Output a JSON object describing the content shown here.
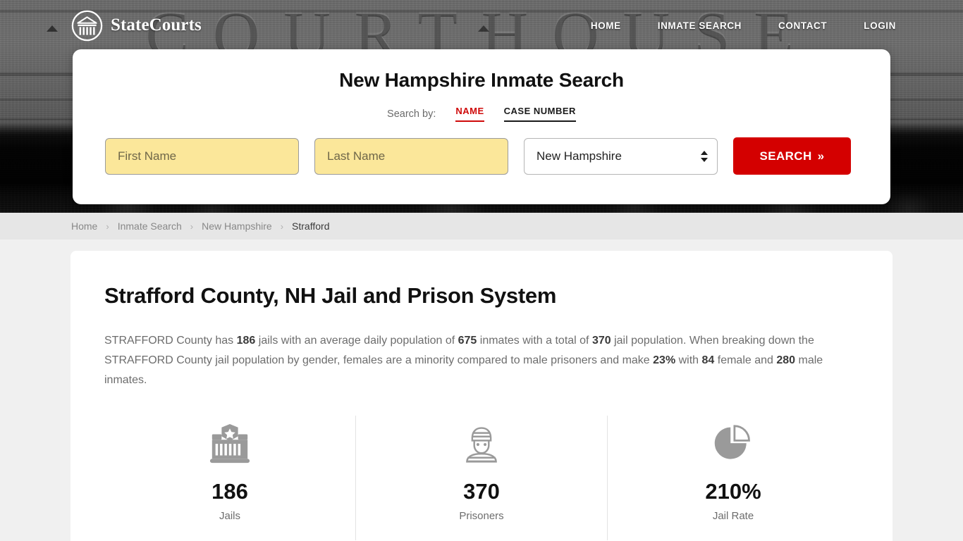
{
  "header": {
    "brand_name": "StateCourts",
    "brand_icon": "courthouse-logo-icon",
    "hero_watermark": "COURTHOUSE",
    "nav": [
      {
        "label": "HOME"
      },
      {
        "label": "INMATE SEARCH"
      },
      {
        "label": "CONTACT"
      },
      {
        "label": "LOGIN"
      }
    ]
  },
  "search": {
    "title": "New Hampshire Inmate Search",
    "search_by_label": "Search by:",
    "tabs": [
      {
        "label": "NAME",
        "active": true,
        "color": "#cf0a0a"
      },
      {
        "label": "CASE NUMBER",
        "active": false,
        "color": "#1a1a1a"
      }
    ],
    "first_name_placeholder": "First Name",
    "first_name_value": "",
    "last_name_placeholder": "Last Name",
    "last_name_value": "",
    "state_selected": "New Hampshire",
    "state_options": [
      "New Hampshire"
    ],
    "submit_label": "SEARCH",
    "submit_chevron": "»",
    "submit_color": "#d40000"
  },
  "breadcrumb": {
    "items": [
      {
        "label": "Home",
        "current": false
      },
      {
        "label": "Inmate Search",
        "current": false
      },
      {
        "label": "New Hampshire",
        "current": false
      },
      {
        "label": "Strafford",
        "current": true
      }
    ],
    "separator": "›"
  },
  "main": {
    "page_title": "Strafford County, NH Jail and Prison System",
    "paragraph": {
      "p1": "STRAFFORD County has ",
      "b1": "186",
      "p2": " jails with an average daily population of ",
      "b2": "675",
      "p3": " inmates with a total of ",
      "b3": "370",
      "p4": " jail population. When breaking down the STRAFFORD County jail population by gender, females are a minority compared to male prisoners and make ",
      "b4": "23%",
      "p5": " with ",
      "b5": "84",
      "p6": " female and ",
      "b6": "280",
      "p7": " male inmates."
    },
    "stats": [
      {
        "icon": "jail-building-icon",
        "value": "186",
        "label": "Jails"
      },
      {
        "icon": "prisoner-icon",
        "value": "370",
        "label": "Prisoners"
      },
      {
        "icon": "pie-chart-icon",
        "value": "210%",
        "label": "Jail Rate"
      }
    ]
  }
}
